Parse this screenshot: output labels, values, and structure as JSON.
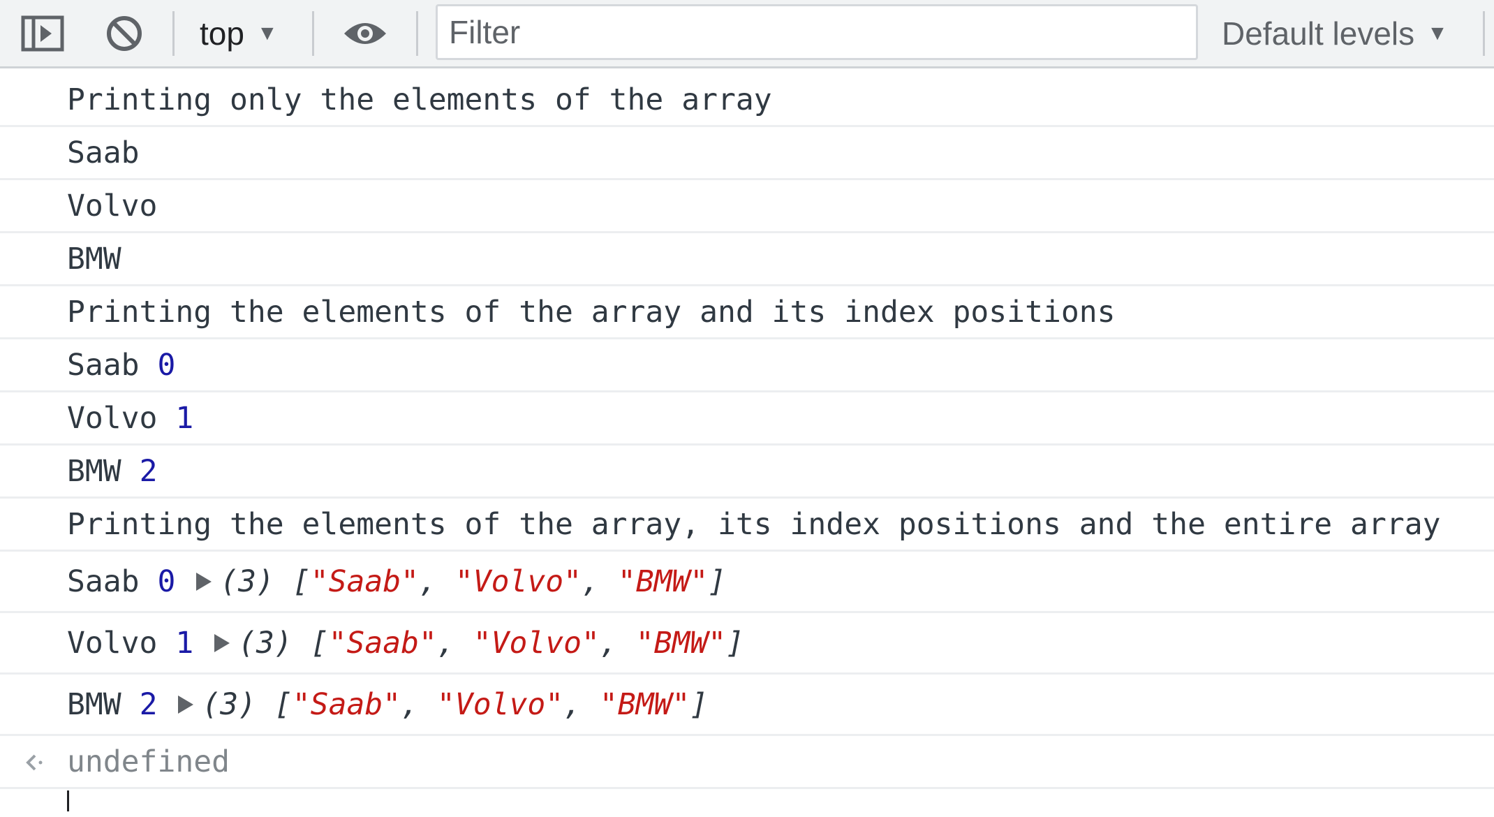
{
  "toolbar": {
    "context_label": "top",
    "filter_placeholder": "Filter",
    "levels_label": "Default levels"
  },
  "icons": {
    "sidebar": "sidebar-toggle-icon",
    "clear": "clear-console-icon",
    "eye": "live-expression-eye-icon",
    "dropdown": "chevron-down-icon",
    "result": "return-arrow-icon"
  },
  "colors": {
    "number": "#1a1aa6",
    "string": "#c41a16",
    "text": "#303942",
    "toolbar_bg": "#f1f3f4"
  },
  "console": {
    "line1": "Printing only the elements of the array",
    "line2": "Saab",
    "line3": "Volvo",
    "line4": "BMW",
    "line5": "Printing the elements of the array and its index positions",
    "line6": {
      "name": "Saab",
      "index": "0"
    },
    "line7": {
      "name": "Volvo",
      "index": "1"
    },
    "line8": {
      "name": "BMW",
      "index": "2"
    },
    "line9": "Printing the elements of the array, its index positions and the entire array",
    "line10": {
      "name": "Saab",
      "index": "0",
      "count": "(3)",
      "items": [
        "\"Saab\"",
        "\"Volvo\"",
        "\"BMW\""
      ]
    },
    "line11": {
      "name": "Volvo",
      "index": "1",
      "count": "(3)",
      "items": [
        "\"Saab\"",
        "\"Volvo\"",
        "\"BMW\""
      ]
    },
    "line12": {
      "name": "BMW",
      "index": "2",
      "count": "(3)",
      "items": [
        "\"Saab\"",
        "\"Volvo\"",
        "\"BMW\""
      ]
    },
    "result": "undefined"
  }
}
